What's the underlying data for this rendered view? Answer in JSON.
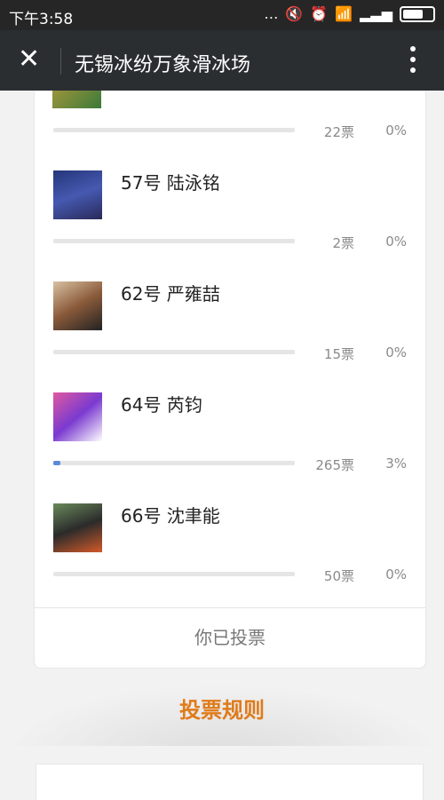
{
  "status_bar": {
    "time": "下午3:58"
  },
  "app_bar": {
    "title": "无锡冰纷万象滑冰场"
  },
  "candidates": [
    {
      "name": "",
      "votes": "22票",
      "percent": "0%",
      "fill": 0
    },
    {
      "name": "57号 陆泳铭",
      "votes": "2票",
      "percent": "0%",
      "fill": 0
    },
    {
      "name": "62号 严雍喆",
      "votes": "15票",
      "percent": "0%",
      "fill": 0
    },
    {
      "name": "64号 芮钧",
      "votes": "265票",
      "percent": "3%",
      "fill": 0.03
    },
    {
      "name": "66号 沈聿能",
      "votes": "50票",
      "percent": "0%",
      "fill": 0
    }
  ],
  "voted_label": "你已投票",
  "rules_title": "投票规则",
  "colors": {
    "accent_orange": "#e07b1a",
    "bar_fill": "#5a8bd8",
    "app_bar": "#2b2e31"
  }
}
